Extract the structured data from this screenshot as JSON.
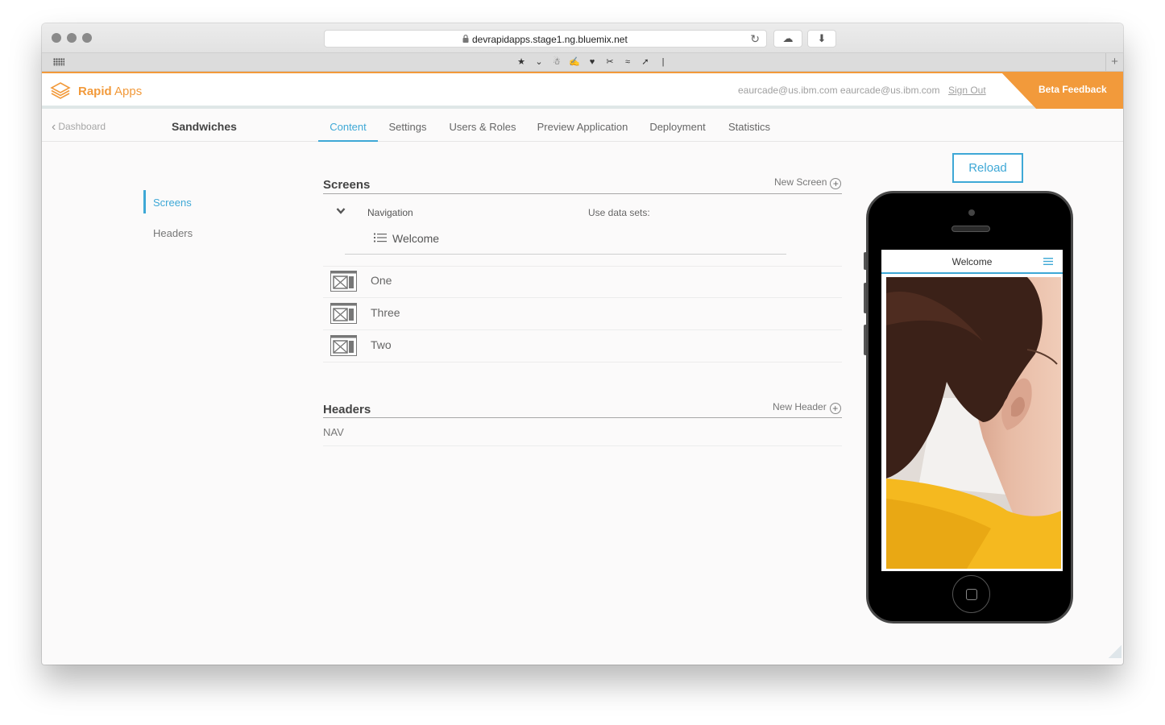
{
  "browser": {
    "url": "devrapidapps.stage1.ng.bluemix.net",
    "bookmark_icons": [
      "★",
      "⌄",
      "☃",
      "✍",
      "♥",
      "✂",
      "≈",
      "➚",
      "|"
    ]
  },
  "header": {
    "brand_bold": "Rapid",
    "brand_light": " Apps",
    "user_email": "eaurcade@us.ibm.com eaurcade@us.ibm.com",
    "sign_out": "Sign Out",
    "beta_feedback": "Beta Feedback"
  },
  "subnav": {
    "back_label": "Dashboard",
    "app_name": "Sandwiches",
    "tabs": [
      {
        "label": "Content",
        "active": true
      },
      {
        "label": "Settings",
        "active": false
      },
      {
        "label": "Users & Roles",
        "active": false
      },
      {
        "label": "Preview Application",
        "active": false
      },
      {
        "label": "Deployment",
        "active": false
      },
      {
        "label": "Statistics",
        "active": false
      }
    ]
  },
  "sidebar": {
    "items": [
      {
        "label": "Screens",
        "active": true
      },
      {
        "label": "Headers",
        "active": false
      }
    ]
  },
  "screens": {
    "title": "Screens",
    "new_label": "New Screen",
    "navigation_label": "Navigation",
    "use_data_sets_label": "Use data sets:",
    "navigation_items": [
      "Welcome"
    ],
    "items": [
      "One",
      "Three",
      "Two"
    ]
  },
  "headers": {
    "title": "Headers",
    "new_label": "New Header",
    "items": [
      "NAV"
    ]
  },
  "preview": {
    "reload_label": "Reload",
    "screen_title": "Welcome"
  },
  "colors": {
    "brand_orange": "#f29a3b",
    "accent_blue": "#3ea8d6"
  }
}
